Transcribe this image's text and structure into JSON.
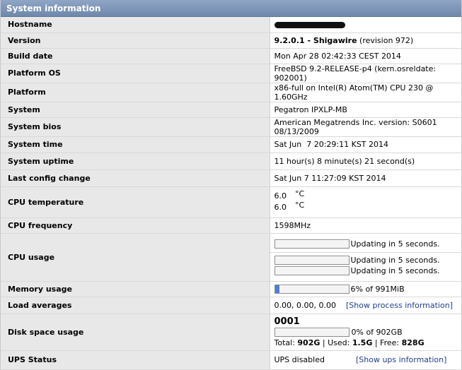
{
  "panel": {
    "title": "System information"
  },
  "rows": {
    "hostname": {
      "label": "Hostname"
    },
    "version": {
      "label": "Version",
      "number": "9.2.0.1",
      "sep": " - ",
      "name": "Shigawire",
      "revision": " (revision 972)"
    },
    "build_date": {
      "label": "Build date",
      "value": "Mon Apr 28 02:42:33 CEST 2014"
    },
    "platform_os": {
      "label": "Platform OS",
      "value": "FreeBSD 9.2-RELEASE-p4 (kern.osreldate: 902001)"
    },
    "platform": {
      "label": "Platform",
      "value": "x86-full on Intel(R) Atom(TM) CPU 230 @ 1.60GHz"
    },
    "system": {
      "label": "System",
      "value": "Pegatron IPXLP-MB"
    },
    "system_bios": {
      "label": "System bios",
      "value": "American Megatrends Inc. version: S0601 08/13/2009"
    },
    "system_time": {
      "label": "System time",
      "value": "Sat Jun  7 20:29:11 KST 2014"
    },
    "system_uptime": {
      "label": "System uptime",
      "value": "11 hour(s) 8 minute(s) 21 second(s)"
    },
    "last_config_change": {
      "label": "Last config change",
      "value": "Sat Jun 7 11:27:09 KST 2014"
    },
    "cpu_temperature": {
      "label": "CPU temperature",
      "values": [
        "6.0",
        "6.0"
      ],
      "unit": "°C"
    },
    "cpu_frequency": {
      "label": "CPU frequency",
      "value": "1598MHz"
    },
    "cpu_usage": {
      "label": "CPU usage",
      "bars": [
        {
          "percent": 0,
          "text": "Updating in 5 seconds."
        },
        {
          "percent": 0,
          "text": "Updating in 5 seconds."
        },
        {
          "percent": 0,
          "text": "Updating in 5 seconds."
        }
      ]
    },
    "memory_usage": {
      "label": "Memory usage",
      "percent": 6,
      "text": "6% of 991MiB"
    },
    "load_averages": {
      "label": "Load averages",
      "value": "0.00, 0.00, 0.00",
      "link": "[Show process information]"
    },
    "disk_space_usage": {
      "label": "Disk space usage",
      "disk_name": "0001",
      "percent": 0,
      "text": "0% of 902GB",
      "total_label": "Total: ",
      "total": "902G",
      "used_label": " | Used: ",
      "used": "1.5G",
      "free_label": " | Free: ",
      "free": "828G"
    },
    "ups_status": {
      "label": "UPS Status",
      "value": "UPS disabled",
      "link": "[Show ups information]"
    }
  },
  "colors": {
    "title_bg": "#7a91b4",
    "label_bg": "#e8e8e8",
    "bar_fill": "#4f7fd1"
  }
}
